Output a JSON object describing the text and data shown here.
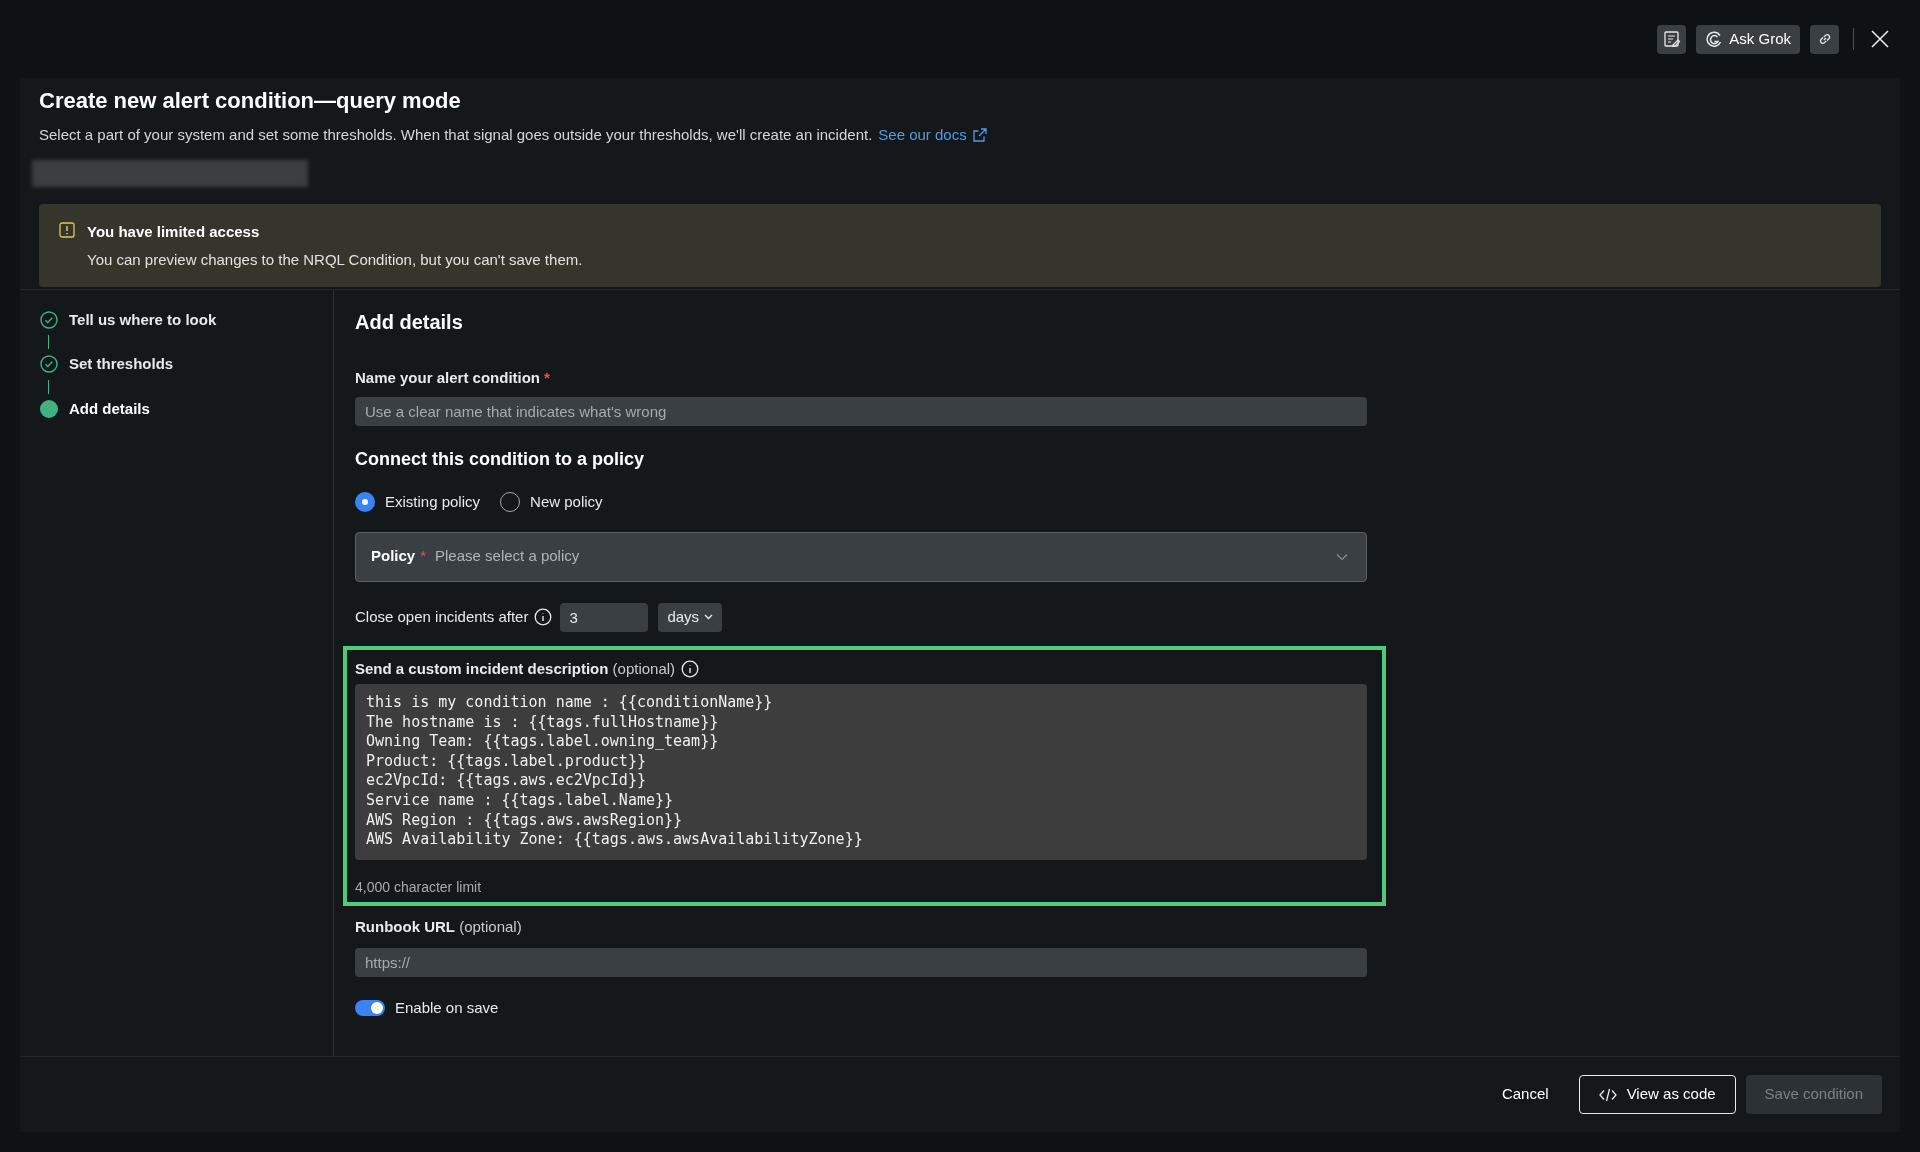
{
  "toolbar": {
    "ask_button": "Ask Grok"
  },
  "header": {
    "title": "Create new alert condition—query mode",
    "description": "Select a part of your system and set some thresholds. When that signal goes outside your thresholds, we'll create an incident.",
    "docs_link": "See our docs"
  },
  "banner": {
    "title": "You have limited access",
    "message": "You can preview changes to the NRQL Condition, but you can't save them."
  },
  "steps": [
    {
      "label": "Tell us where to look",
      "done": true,
      "selected": false
    },
    {
      "label": "Set thresholds",
      "done": true,
      "selected": false
    },
    {
      "label": "Add details",
      "done": false,
      "selected": true
    }
  ],
  "form": {
    "heading": "Add details",
    "name_label": "Name your alert condition",
    "name_required": "*",
    "name_placeholder": "Use a clear name that indicates what's wrong",
    "policy_heading": "Connect this condition to a policy",
    "policy_options": [
      {
        "label": "Existing policy",
        "selected": true
      },
      {
        "label": "New policy",
        "selected": false
      }
    ],
    "policy_select": {
      "label": "Policy",
      "required": "*",
      "placeholder": "Please select a policy"
    },
    "close_label": "Close open incidents after",
    "close_value": "3",
    "close_unit": "days",
    "description_label": "Send a custom incident description",
    "description_optional": "(optional)",
    "description_lines": [
      "this is my condition name : {{conditionName}}",
      "The hostname is : {{tags.fullHostname}}",
      "Owning Team: {{tags.label.owning_team}}",
      "Product: {{tags.label.product}}",
      "ec2VpcId: {{tags.aws.ec2VpcId}}",
      "Service name : {{tags.label.Name}}",
      "AWS Region : {{tags.aws.awsRegion}}",
      "AWS Availability Zone: {{tags.aws.awsAvailabilityZone}}"
    ],
    "description_limit": "4,000 character limit",
    "runbook_label": "Runbook URL",
    "runbook_optional": "(optional)",
    "runbook_placeholder": "https://",
    "enable_toggle": {
      "label": "Enable on save",
      "on": true
    }
  },
  "footer": {
    "cancel": "Cancel",
    "view_code": "View as code",
    "save": "Save condition",
    "save_disabled": true
  }
}
